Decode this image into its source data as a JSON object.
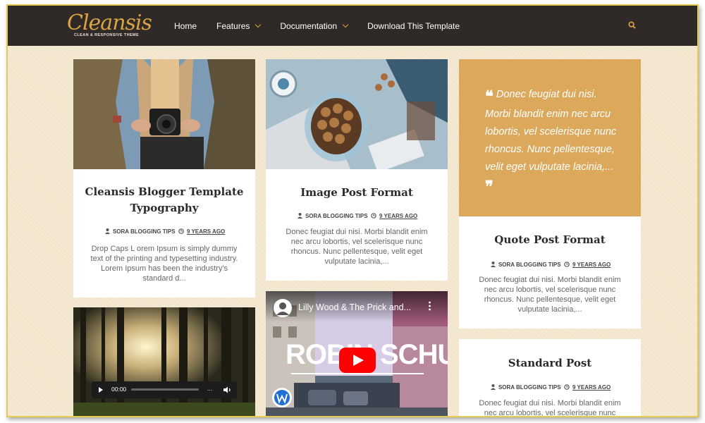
{
  "brand": {
    "name": "Cleansis",
    "tagline": "CLEAN & RESPONSIVE THEME",
    "accent": "#d9a441",
    "nav_bg": "#2f2a28",
    "page_bg": "#f5e8d0",
    "quote_bg": "#dca85c"
  },
  "nav": {
    "items": [
      {
        "label": "Home",
        "dropdown": false
      },
      {
        "label": "Features",
        "dropdown": true
      },
      {
        "label": "Documentation",
        "dropdown": true
      },
      {
        "label": "Download This Template",
        "dropdown": false
      }
    ],
    "search_icon": "search-icon"
  },
  "posts": {
    "typography": {
      "title": "Cleansis Blogger Template Typography",
      "author": "SORA BLOGGING TIPS",
      "time": "9 YEARS AGO",
      "excerpt": "Drop Caps L orem Ipsum is simply dummy text of the printing and typesetting industry. Lorem Ipsum has been the industry's standard d..."
    },
    "image": {
      "title": "Image Post Format",
      "author": "SORA BLOGGING TIPS",
      "time": "9 YEARS AGO",
      "excerpt": "Donec feugiat dui nisi. Morbi blandit enim nec arcu lobortis, vel scelerisque nunc rhoncus. Nunc pellentesque, velit eget vulputate lacinia,..."
    },
    "quote": {
      "quote_text": "Donec feugiat dui nisi. Morbi blandit enim nec arcu lobortis, vel scelerisque nunc rhoncus. Nunc pellentesque, velit eget vulputate lacinia,...",
      "title": "Quote Post Format",
      "author": "SORA BLOGGING TIPS",
      "time": "9 YEARS AGO",
      "excerpt": "Donec feugiat dui nisi. Morbi blandit enim nec arcu lobortis, vel scelerisque nunc rhoncus. Nunc pellentesque, velit eget vulputate lacinia,..."
    },
    "standard": {
      "title": "Standard Post",
      "author": "SORA BLOGGING TIPS",
      "time": "9 YEARS AGO",
      "excerpt": "Donec feugiat dui nisi. Morbi blandit enim nec arcu lobortis, vel scelerisque nunc"
    },
    "audio": {
      "current_time": "00:00",
      "more": "..."
    },
    "video": {
      "title": "Lilly Wood & The Prick and...",
      "overlay_text": "ROBIN SCHULZ"
    }
  }
}
